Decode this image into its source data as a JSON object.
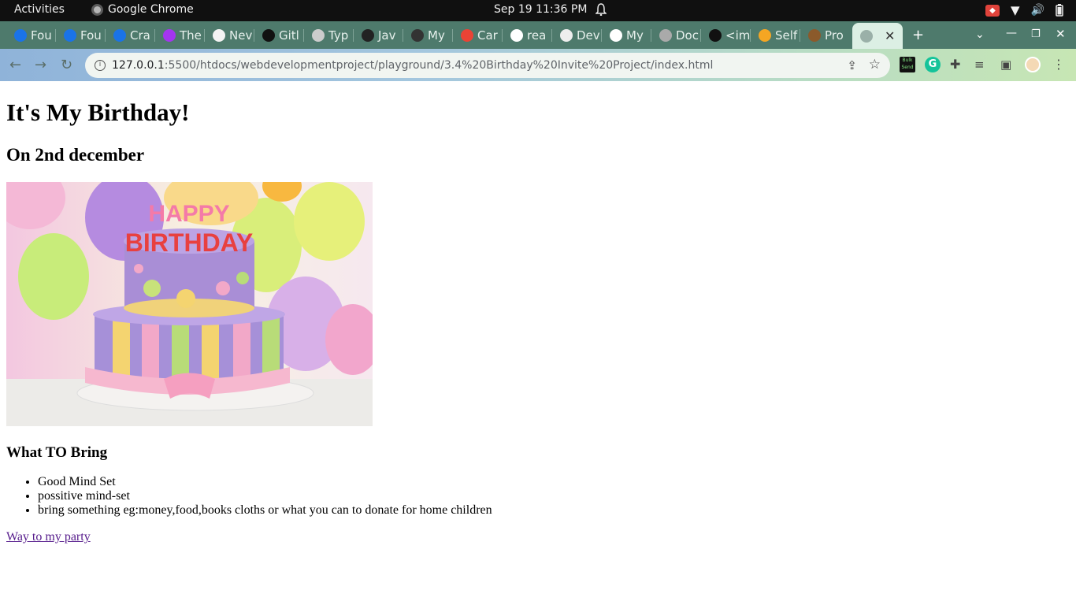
{
  "system": {
    "activities": "Activities",
    "app_name": "Google Chrome",
    "clock": "Sep 19  11:36 PM"
  },
  "tabs": [
    {
      "label": "Fou",
      "icon": "coursera-icon",
      "color": "#1a73e8"
    },
    {
      "label": "Fou",
      "icon": "coursera-icon",
      "color": "#1a73e8"
    },
    {
      "label": "Cra",
      "icon": "coursera-icon",
      "color": "#1a73e8"
    },
    {
      "label": "The",
      "icon": "udemy-icon",
      "color": "#a435f0"
    },
    {
      "label": "Nev",
      "icon": "bookmark-icon",
      "color": "#f3f3f3"
    },
    {
      "label": "Gitl",
      "icon": "github-icon",
      "color": "#111111"
    },
    {
      "label": "Typ",
      "icon": "document-icon",
      "color": "#cccccc"
    },
    {
      "label": "Jav",
      "icon": "code-icon",
      "color": "#222222"
    },
    {
      "label": "My",
      "icon": "figma-icon",
      "color": "#333333"
    },
    {
      "label": "Car",
      "icon": "pinwheel-icon",
      "color": "#ea4335"
    },
    {
      "label": "rea",
      "icon": "google-icon",
      "color": "#ffffff"
    },
    {
      "label": "Dev",
      "icon": "search-doc-icon",
      "color": "#eeeeee"
    },
    {
      "label": "My",
      "icon": "profile-icon",
      "color": "#ffffff"
    },
    {
      "label": "Doc",
      "icon": "globe-icon",
      "color": "#aaaaaa"
    },
    {
      "label": "<im",
      "icon": "m-icon",
      "color": "#111111"
    },
    {
      "label": "Self",
      "icon": "bowl-icon",
      "color": "#f5a623"
    },
    {
      "label": "Pro",
      "icon": "picture-icon",
      "color": "#8b5a2b"
    }
  ],
  "active_tab": {
    "icon": "globe-icon",
    "close": "✕"
  },
  "address_bar": {
    "host": "127.0.0.1",
    "path": ":5500/htdocs/webdevelopmentproject/playground/3.4%20Birthday%20Invite%20Project/index.html"
  },
  "extensions": {
    "bulk_label": "Bulk Send"
  },
  "page": {
    "title": "It's My Birthday!",
    "subtitle": "On 2nd december",
    "bring_heading": "What TO Bring",
    "bring_items": [
      "Good Mind Set",
      "possitive mind-set",
      "bring something eg:money,food,books cloths or what you can to donate for home children"
    ],
    "link_text": "Way to my party",
    "cake_text": "HAPPY BIRTHDAY"
  }
}
